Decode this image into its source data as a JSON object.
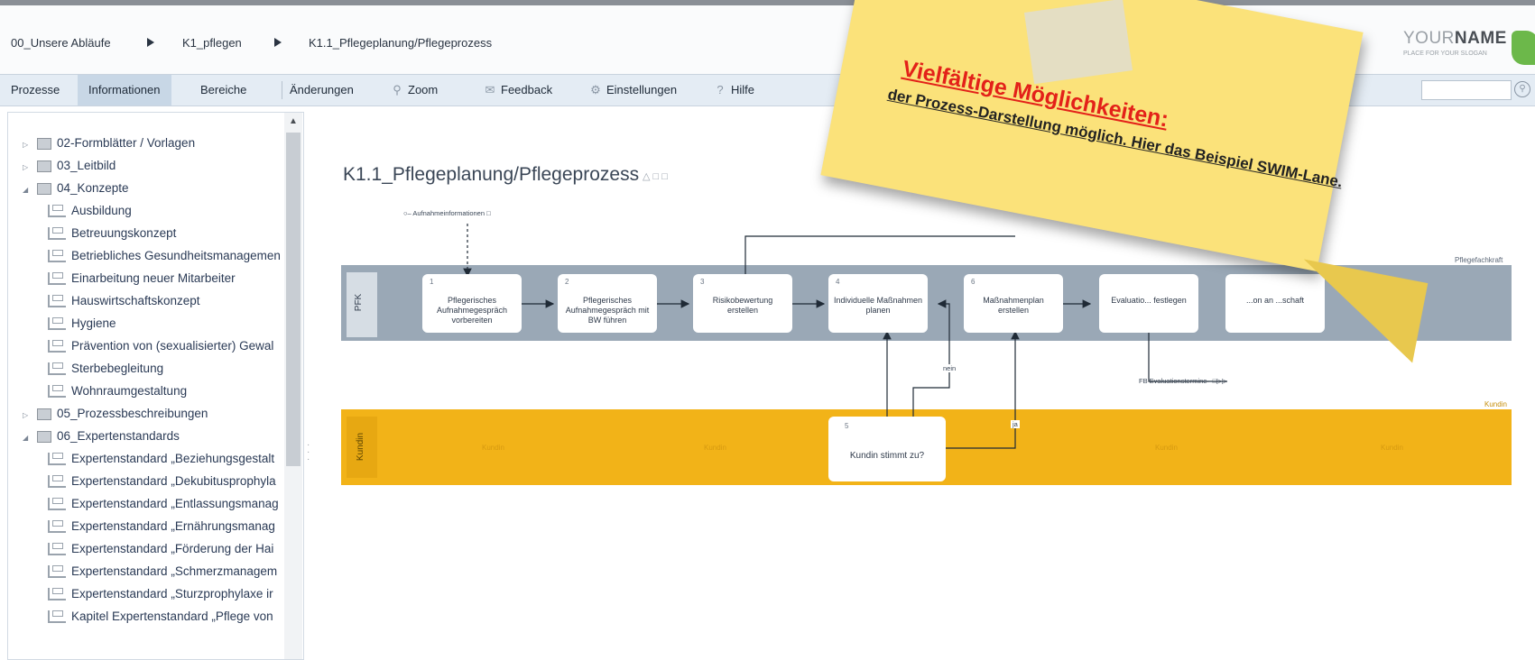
{
  "breadcrumb": [
    "00_Unsere Abläufe",
    "K1_pflegen",
    "K1.1_Pflegeplanung/Pflegeprozess"
  ],
  "logo": {
    "main_light": "YOUR",
    "main_bold": "NAME",
    "sub": "PLACE FOR YOUR SLOGAN"
  },
  "toolbar": {
    "prozesse": "Prozesse",
    "informationen": "Informationen",
    "bereiche": "Bereiche",
    "aenderungen": "Änderungen",
    "zoom": "Zoom",
    "feedback": "Feedback",
    "einstellungen": "Einstellungen",
    "hilfe": "Hilfe"
  },
  "tree": [
    "02-Formblätter / Vorlagen",
    "03_Leitbild",
    "04_Konzepte",
    "Ausbildung",
    "Betreuungskonzept",
    "Betriebliches Gesundheitsmanagemen",
    "Einarbeitung neuer Mitarbeiter",
    "Hauswirtschaftskonzept",
    "Hygiene",
    "Prävention von (sexualisierter) Gewal",
    "Sterbebegleitung",
    "Wohnraumgestaltung",
    "05_Prozessbeschreibungen",
    "06_Expertenstandards",
    "Expertenstandard „Beziehungsgestalt",
    "Expertenstandard „Dekubitusprophyla",
    "Expertenstandard „Entlassungsmanag",
    "Expertenstandard „Ernährungsmanag",
    "Expertenstandard „Förderung der Hai",
    "Expertenstandard „Schmerzmanagem",
    "Expertenstandard „Sturzprophylaxe ir",
    "Kapitel Expertenstandard „Pflege von"
  ],
  "process": {
    "title": "K1.1_Pflegeplanung/Pflegeprozess",
    "input_doc": "Aufnahmeinformationen",
    "lane1": "PFK",
    "lane1_caption": "Pflegefachkraft",
    "lane2": "Kundin",
    "lane2_caption": "Kundin",
    "lane2_watermarks": [
      "Kundin",
      "Kundin",
      "Kundin",
      "Kundin"
    ],
    "tasks": [
      {
        "no": "1",
        "label": "Pflegerisches Aufnahmegespräch vorbereiten"
      },
      {
        "no": "2",
        "label": "Pflegerisches Aufnahmegespräch mit BW führen"
      },
      {
        "no": "3",
        "label": "Risikobewertung erstellen"
      },
      {
        "no": "4",
        "label": "Individuelle Maßnahmen planen"
      },
      {
        "no": "6",
        "label": "Maßnahmenplan erstellen"
      },
      {
        "no": "",
        "label": "Evaluatio... festlegen"
      },
      {
        "no": "",
        "label": "...on an ...schaft"
      }
    ],
    "decision": {
      "no": "5",
      "label": "Kundin stimmt zu?"
    },
    "edge_nein": "nein",
    "edge_ja": "ja",
    "output_doc": "FB Evaluationstermine"
  },
  "note": {
    "heading": "Vielfältige Möglichkeiten:",
    "text": "der Prozess-Darstellung möglich. Hier das Beispiel SWIM-Lane."
  }
}
